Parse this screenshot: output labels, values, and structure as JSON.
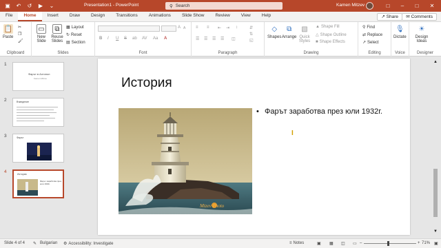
{
  "titlebar": {
    "autosave_label": "AutoSave",
    "autosave_state": "Off",
    "doc_title": "Presentation1 - PowerPoint",
    "search_placeholder": "Search",
    "user_name": "Kamen Mitzev"
  },
  "tabs": [
    "File",
    "Home",
    "Insert",
    "Draw",
    "Design",
    "Transitions",
    "Animations",
    "Slide Show",
    "Review",
    "View",
    "Help"
  ],
  "active_tab": "Home",
  "share_label": "Share",
  "comments_label": "Comments",
  "ribbon": {
    "clipboard": {
      "paste": "Paste",
      "group": "Clipboard"
    },
    "slides": {
      "new_slide": "New Slide",
      "reuse": "Reuse Slides",
      "layout": "Layout",
      "reset": "Reset",
      "section": "Section",
      "group": "Slides"
    },
    "font": {
      "group": "Font",
      "bold": "B",
      "italic": "I",
      "underline": "U",
      "strike": "S",
      "shadow": "ab",
      "spacing": "AV",
      "case": "Aa",
      "size_up": "A",
      "size_down": "A",
      "clear": "A"
    },
    "paragraph": {
      "group": "Paragraph"
    },
    "drawing": {
      "shapes": "Shapes",
      "arrange": "Arrange",
      "quick_styles": "Quick Styles",
      "shape_fill": "Shape Fill",
      "shape_outline": "Shape Outline",
      "shape_effects": "Shape Effects",
      "group": "Drawing"
    },
    "editing": {
      "find": "Find",
      "replace": "Replace",
      "select": "Select",
      "group": "Editing"
    },
    "voice": {
      "dictate": "Dictate",
      "group": "Voice"
    },
    "designer": {
      "ideas": "Design Ideas",
      "group": "Designer"
    }
  },
  "thumbnails": [
    {
      "num": "1",
      "title": "Фарът в Ахтопол",
      "subtitle": "Kamen Mitzev"
    },
    {
      "num": "2",
      "title": "Въведение"
    },
    {
      "num": "3",
      "title": "Фарът"
    },
    {
      "num": "4",
      "title": "История",
      "text": "Фарът заработва през юли 1932г."
    }
  ],
  "slide": {
    "title": "История",
    "bullet": "Фарът заработва през юли 1932г.",
    "photo_watermark": "Mtzev Photo"
  },
  "status": {
    "slide_info": "Slide 4 of 4",
    "language": "Bulgarian",
    "accessibility": "Accessibility: Investigate",
    "notes": "Notes",
    "zoom": "71%"
  },
  "colors": {
    "accent": "#b7472a"
  }
}
